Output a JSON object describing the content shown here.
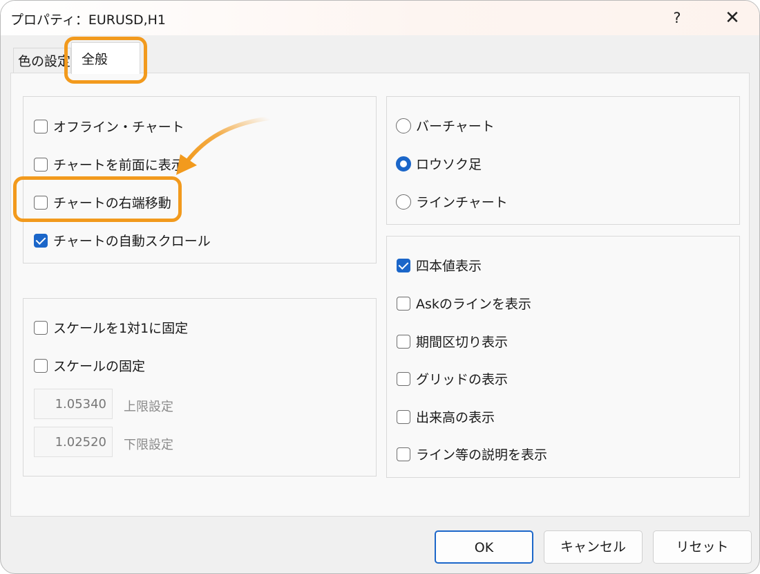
{
  "window": {
    "title": "プロパティ：EURUSD,H1",
    "help_label": "?",
    "close_label": "✕"
  },
  "tabs": [
    {
      "label": "色の設定",
      "active": false
    },
    {
      "label": "全般",
      "active": true
    }
  ],
  "chart_options": {
    "offline_chart": {
      "label": "オフライン・チャート",
      "checked": false
    },
    "chart_foreground": {
      "label": "チャートを前面に表示",
      "checked": false
    },
    "chart_shift": {
      "label": "チャートの右端移動",
      "checked": false
    },
    "chart_autoscroll": {
      "label": "チャートの自動スクロール",
      "checked": true
    }
  },
  "chart_type": {
    "bar": {
      "label": "バーチャート",
      "selected": false
    },
    "candle": {
      "label": "ロウソク足",
      "selected": true
    },
    "line": {
      "label": "ラインチャート",
      "selected": false
    }
  },
  "scale": {
    "scale_1to1": {
      "label": "スケールを1対1に固定",
      "checked": false
    },
    "scale_fix": {
      "label": "スケールの固定",
      "checked": false
    },
    "upper_value": "1.05340",
    "upper_label": "上限設定",
    "lower_value": "1.02520",
    "lower_label": "下限設定"
  },
  "display_options": {
    "ohlc": {
      "label": "四本値表示",
      "checked": true
    },
    "ask_line": {
      "label": "Askのラインを表示",
      "checked": false
    },
    "period_separators": {
      "label": "期間区切り表示",
      "checked": false
    },
    "grid": {
      "label": "グリッドの表示",
      "checked": false
    },
    "volume": {
      "label": "出来高の表示",
      "checked": false
    },
    "object_descriptions": {
      "label": "ライン等の説明を表示",
      "checked": false
    }
  },
  "buttons": {
    "ok": "OK",
    "cancel": "キャンセル",
    "reset": "リセット"
  },
  "colors": {
    "accent": "#1b66c9",
    "highlight": "#f29a1d"
  }
}
